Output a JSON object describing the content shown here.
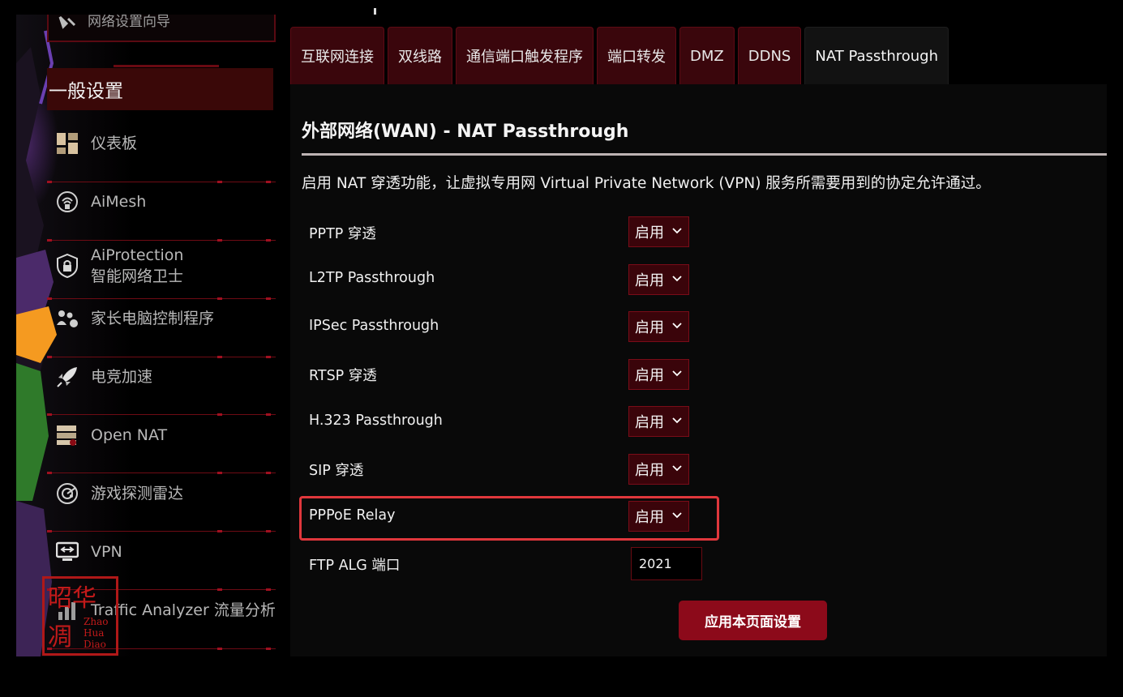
{
  "sidebar": {
    "top_item": "网络设置向导",
    "section_header": "一般设置",
    "items": [
      {
        "label": "仪表板",
        "icon": "dashboard-icon"
      },
      {
        "label": "AiMesh",
        "icon": "aimesh-icon"
      },
      {
        "label": "AiProtection",
        "label2": "智能网络卫士",
        "icon": "shield-lock-icon"
      },
      {
        "label": "家长电脑控制程序",
        "icon": "parental-control-icon"
      },
      {
        "label": "电竞加速",
        "icon": "rocket-icon"
      },
      {
        "label": "Open NAT",
        "icon": "open-nat-icon"
      },
      {
        "label": "游戏探测雷达",
        "icon": "radar-icon"
      },
      {
        "label": "VPN",
        "icon": "vpn-icon"
      },
      {
        "label": "Traffic Analyzer 流量分析",
        "icon": "traffic-analyzer-icon"
      }
    ],
    "stamp": {
      "chars": "昭华凋",
      "latin": [
        "Zhao",
        "Hua",
        "Diao"
      ]
    }
  },
  "tabs": [
    {
      "label": "互联网连接",
      "active": false
    },
    {
      "label": "双线路",
      "active": false
    },
    {
      "label": "通信端口触发程序",
      "active": false
    },
    {
      "label": "端口转发",
      "active": false
    },
    {
      "label": "DMZ",
      "active": false
    },
    {
      "label": "DDNS",
      "active": false
    },
    {
      "label": "NAT Passthrough",
      "active": true
    }
  ],
  "main": {
    "title": "外部网络(WAN) - NAT Passthrough",
    "description": "启用 NAT 穿透功能，让虚拟专用网 Virtual Private Network (VPN) 服务所需要用到的协定允许通过。",
    "rows": [
      {
        "label": "PPTP 穿透",
        "value": "启用"
      },
      {
        "label": "L2TP Passthrough",
        "value": "启用"
      },
      {
        "label": "IPSec Passthrough",
        "value": "启用"
      },
      {
        "label": "RTSP 穿透",
        "value": "启用"
      },
      {
        "label": "H.323 Passthrough",
        "value": "启用"
      },
      {
        "label": "SIP 穿透",
        "value": "启用"
      },
      {
        "label": "PPPoE Relay",
        "value": "启用",
        "highlighted": true
      }
    ],
    "ftp_alg": {
      "label": "FTP ALG 端口",
      "value": "2021"
    },
    "apply_button": "应用本页面设置"
  },
  "colors": {
    "accent_red": "#8c0a1a",
    "tab_bg": "#3a060c",
    "highlight_box": "#e0373c",
    "panel_bg": "#090909"
  }
}
